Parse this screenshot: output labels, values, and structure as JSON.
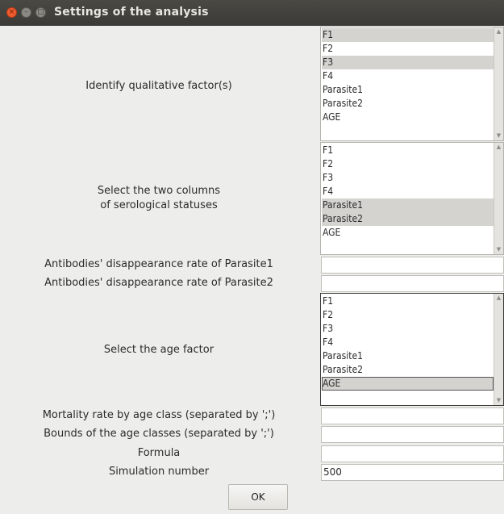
{
  "window": {
    "title": "Settings of the analysis"
  },
  "qualitative": {
    "label": "Identify qualitative factor(s)",
    "items": [
      "F1",
      "F2",
      "F3",
      "F4",
      "Parasite1",
      "Parasite2",
      "AGE"
    ],
    "selected": [
      0,
      2
    ]
  },
  "serological": {
    "label_line1": "Select the two columns",
    "label_line2": "of serological statuses",
    "items": [
      "F1",
      "F2",
      "F3",
      "F4",
      "Parasite1",
      "Parasite2",
      "AGE"
    ],
    "selected": [
      4,
      5
    ]
  },
  "antibodies1": {
    "label": "Antibodies' disappearance rate of Parasite1",
    "value": ""
  },
  "antibodies2": {
    "label": "Antibodies' disappearance rate of Parasite2",
    "value": ""
  },
  "age_factor": {
    "label": "Select the age factor",
    "items": [
      "F1",
      "F2",
      "F3",
      "F4",
      "Parasite1",
      "Parasite2",
      "AGE"
    ],
    "selected": [
      6
    ]
  },
  "mortality": {
    "label": "Mortality rate by age class (separated by ';')",
    "value": ""
  },
  "bounds": {
    "label": "Bounds of the age classes (separated by ';')",
    "value": ""
  },
  "formula": {
    "label": "Formula",
    "value": ""
  },
  "simulation": {
    "label": "Simulation number",
    "value": "500"
  },
  "ok_button": {
    "label": "OK"
  }
}
